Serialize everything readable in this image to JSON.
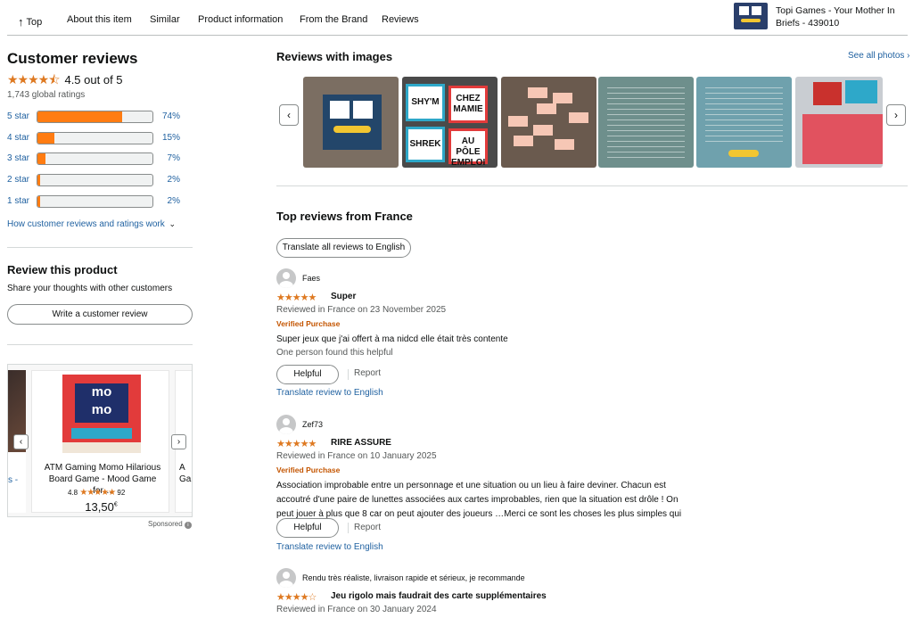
{
  "nav": {
    "top": "Top",
    "items": [
      "About this item",
      "Similar",
      "Product information",
      "From the Brand",
      "Reviews"
    ],
    "product_title": "Topi Games - Your Mother In Briefs - 439010"
  },
  "summary": {
    "heading": "Customer reviews",
    "stars_text": "★★★★⯪",
    "rating_text": "4.5 out of 5",
    "global_ratings": "1,743 global ratings",
    "histogram": [
      {
        "label": "5 star",
        "percent": 74,
        "percent_text": "74%"
      },
      {
        "label": "4 star",
        "percent": 15,
        "percent_text": "15%"
      },
      {
        "label": "3 star",
        "percent": 7,
        "percent_text": "7%"
      },
      {
        "label": "2 star",
        "percent": 2,
        "percent_text": "2%"
      },
      {
        "label": "1 star",
        "percent": 2,
        "percent_text": "2%"
      }
    ],
    "how_link": "How customer reviews and ratings work",
    "review_heading": "Review this product",
    "share_text": "Share your thoughts with other customers",
    "write_button": "Write a customer review"
  },
  "sponsored": {
    "left_partial_text": "s -",
    "card": {
      "brand_text": "mo mo",
      "title": "ATM Gaming Momo Hilarious Board Game - Mood Game for…",
      "rating": "4.8",
      "stars_text": "★★★★★",
      "count": "92",
      "price_main": "13,50",
      "price_currency": "€"
    },
    "right_partial_text": "A Ga",
    "label": "Sponsored"
  },
  "images_section": {
    "heading": "Reviews with images",
    "see_all": "See all photos",
    "image2_cards": [
      "SHY'M",
      "CHEZ MAMIE",
      "SHREK",
      "AU PÔLE EMPLOI"
    ]
  },
  "top_reviews": {
    "heading": "Top reviews from France",
    "translate_all": "Translate all reviews to English",
    "reviews": [
      {
        "name": "Faes",
        "stars_text": "★★★★★",
        "title": "Super",
        "date": "Reviewed in France on 23 November 2025",
        "verified": "Verified Purchase",
        "body": "Super jeux que j'ai offert à ma nidcd elle était très contente",
        "helpful_note": "One person found this helpful",
        "helpful": "Helpful",
        "report": "Report",
        "translate": "Translate review to English"
      },
      {
        "name": "Zef73",
        "stars_text": "★★★★★",
        "title": "RIRE ASSURE",
        "date": "Reviewed in France on 10 January 2025",
        "verified": "Verified Purchase",
        "body": "Association improbable entre un personnage et une situation ou un lieu à faire deviner. Chacun est accoutré d'une paire de lunettes associées aux cartes improbables, rien que la situation est drôle ! On peut jouer à plus que 8 car on peut ajouter des joueurs …Merci ce sont les choses les plus simples qui amusent.",
        "helpful": "Helpful",
        "report": "Report",
        "translate": "Translate review to English"
      },
      {
        "name": "Rendu très réaliste, livraison rapide et sérieux, je recommande",
        "stars_text": "★★★★☆",
        "title": "Jeu rigolo mais faudrait des carte supplémentaires",
        "date": "Reviewed in France on 30 January 2024"
      }
    ]
  }
}
